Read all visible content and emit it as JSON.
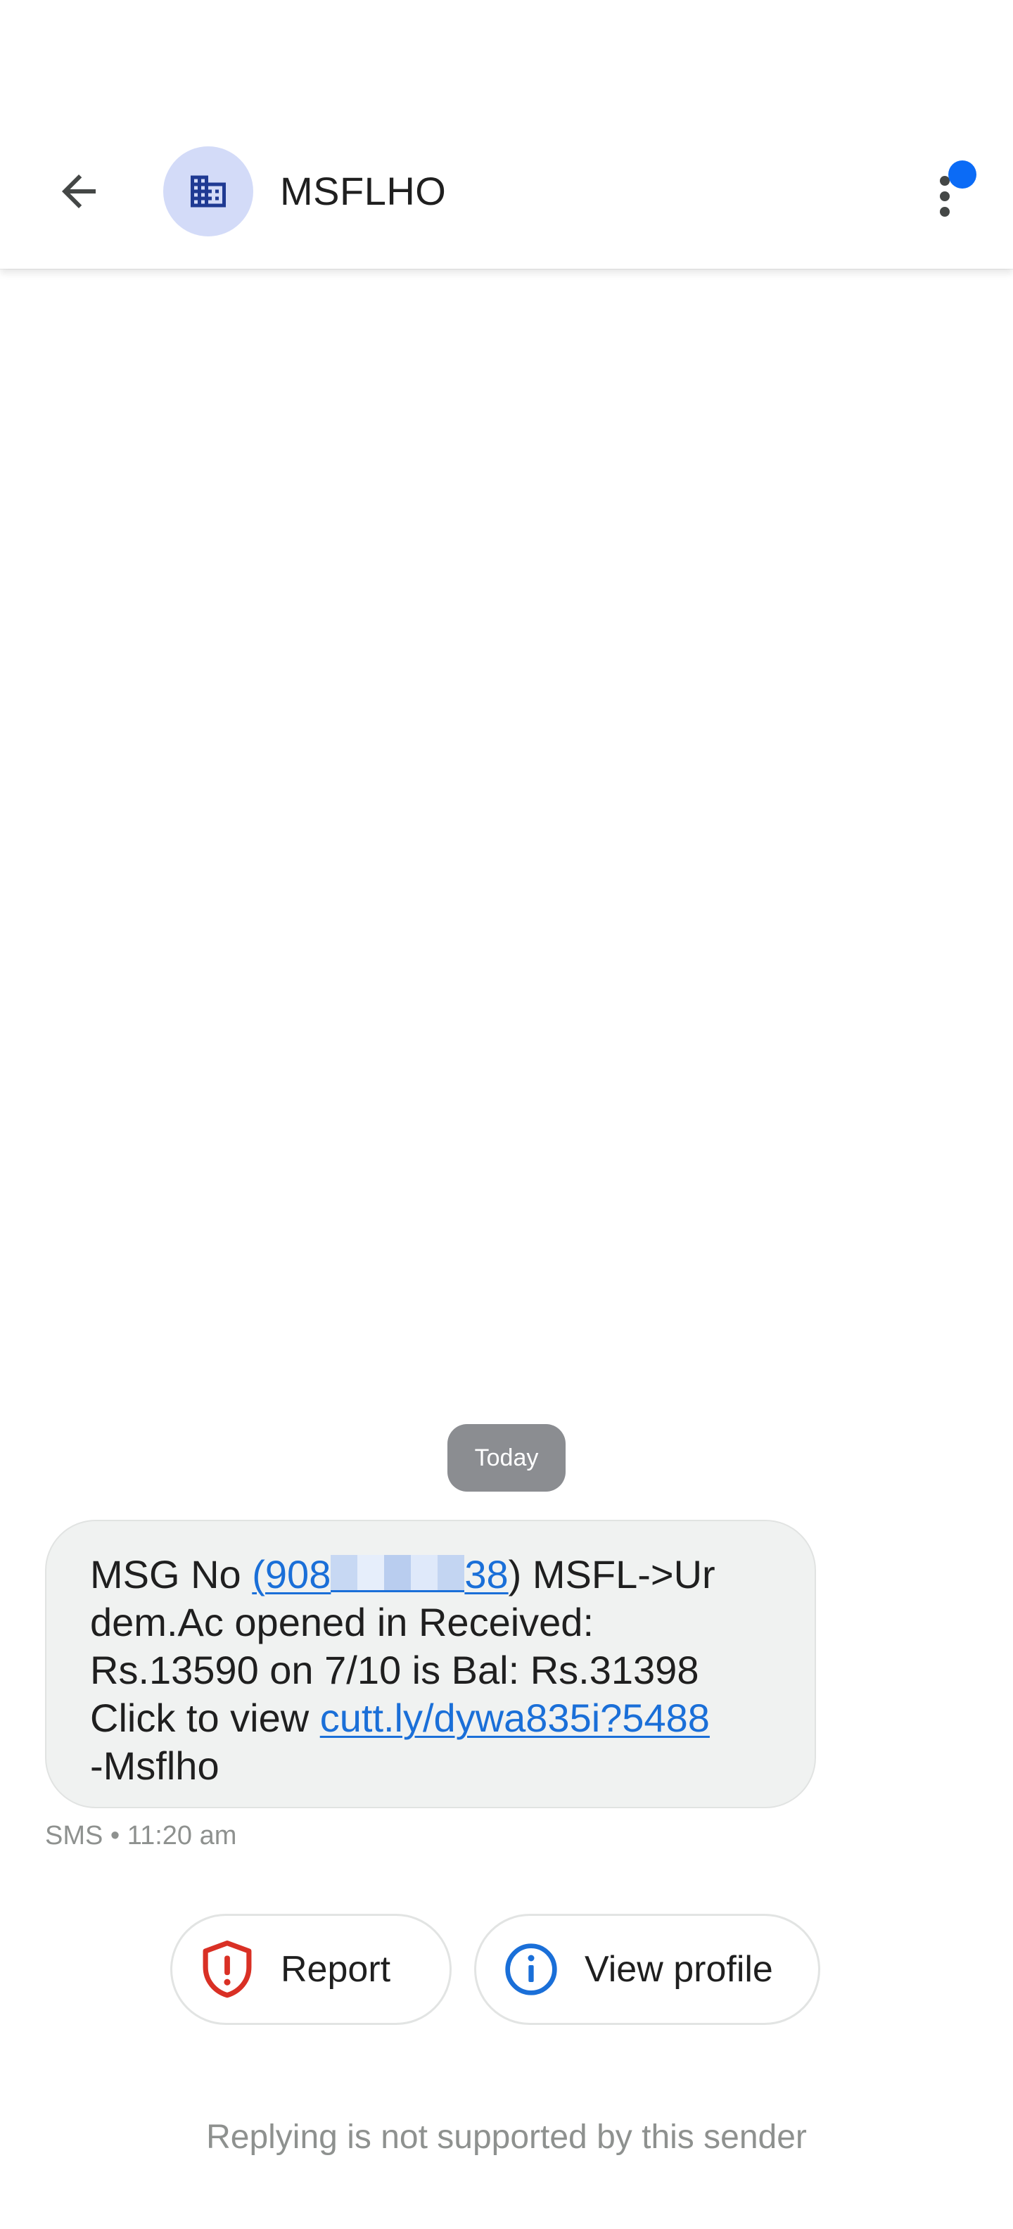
{
  "header": {
    "back_icon": "arrow-back-icon",
    "avatar_icon": "business-building-icon",
    "contact_name": "MSFLHO",
    "more_icon": "more-vert-icon",
    "notification_badge_color": "#0b6bf6"
  },
  "conversation": {
    "date_label": "Today",
    "message": {
      "line1_prefix": "MSG No ",
      "line1_link_start": "(908",
      "line1_link_end": "38",
      "line1_suffix": ") MSFL->Ur",
      "line2": "dem.Ac opened in Received:",
      "line3": "Rs.13590 on 7/10 is Bal: Rs.31398",
      "line4_prefix": "Click to view ",
      "line4_link": "cutt.ly/dywa835i?5488",
      "line5": "-Msflho"
    },
    "meta": "SMS • 11:20 am"
  },
  "actions": {
    "report_label": "Report",
    "report_icon": "shield-alert-icon",
    "view_profile_label": "View profile",
    "view_profile_icon": "info-icon"
  },
  "footer": {
    "note": "Replying is not supported by this sender"
  },
  "colors": {
    "link": "#1a6fd8",
    "bubble": "#f0f2f1",
    "report_icon": "#d93025",
    "info_icon": "#1a6fd8",
    "avatar_bg": "#d3dbf8",
    "avatar_icon": "#1f3a93"
  }
}
